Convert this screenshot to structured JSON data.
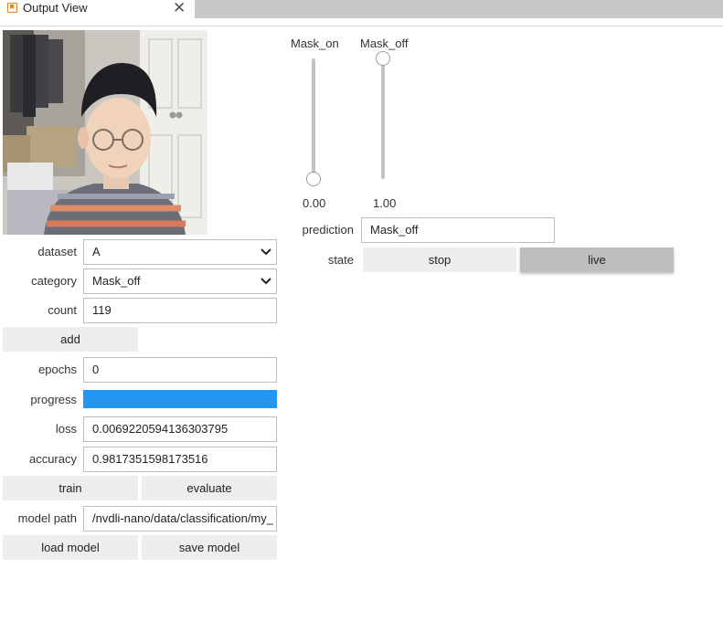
{
  "tab": {
    "title": "Output View",
    "close": "✕"
  },
  "form": {
    "dataset_label": "dataset",
    "dataset_value": "A",
    "category_label": "category",
    "category_value": "Mask_off",
    "count_label": "count",
    "count_value": "119",
    "add_label": "add",
    "epochs_label": "epochs",
    "epochs_value": "0",
    "progress_label": "progress",
    "progress_value": 1.0,
    "loss_label": "loss",
    "loss_value": "0.0069220594136303795",
    "accuracy_label": "accuracy",
    "accuracy_value": "0.9817351598173516",
    "train_label": "train",
    "evaluate_label": "evaluate",
    "model_path_label": "model path",
    "model_path_value": "/nvdli-nano/data/classification/my_",
    "load_label": "load model",
    "save_label": "save model"
  },
  "sliders": [
    {
      "name": "Mask_on",
      "value_text": "0.00",
      "value": 0.0
    },
    {
      "name": "Mask_off",
      "value_text": "1.00",
      "value": 1.0
    }
  ],
  "prediction": {
    "label": "prediction",
    "value": "Mask_off"
  },
  "state": {
    "label": "state",
    "stop_label": "stop",
    "live_label": "live",
    "selected": "live"
  },
  "colors": {
    "progress_fill": "#2196f3",
    "tab_icon": "#e87d1e"
  }
}
